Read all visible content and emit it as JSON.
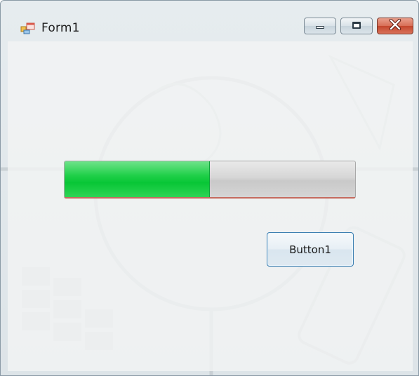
{
  "window": {
    "title": "Form1",
    "app_icon": "form-app-icon",
    "controls": {
      "minimize_icon": "minimize-icon",
      "maximize_icon": "maximize-icon",
      "close_icon": "close-icon"
    }
  },
  "progress_bar": {
    "value_percent": 50,
    "fill_color": "#1fcf48"
  },
  "button1": {
    "label": "Button1"
  },
  "colors": {
    "close_button": "#c4462c",
    "button_border": "#3c7fb1"
  }
}
